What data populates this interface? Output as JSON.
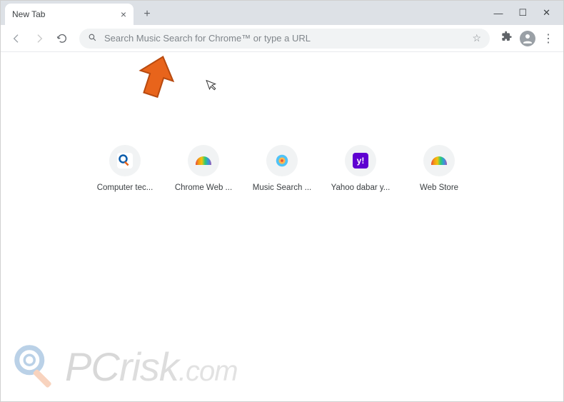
{
  "tab": {
    "title": "New Tab"
  },
  "omnibox": {
    "placeholder": "Search Music Search for Chrome™ or type a URL"
  },
  "shortcuts": [
    {
      "label": "Computer tec..."
    },
    {
      "label": "Chrome Web ..."
    },
    {
      "label": "Music Search ..."
    },
    {
      "label": "Yahoo dabar y..."
    },
    {
      "label": "Web Store"
    }
  ],
  "watermark": {
    "p": "P",
    "c": "C",
    "risk": "risk",
    "com": ".com"
  }
}
